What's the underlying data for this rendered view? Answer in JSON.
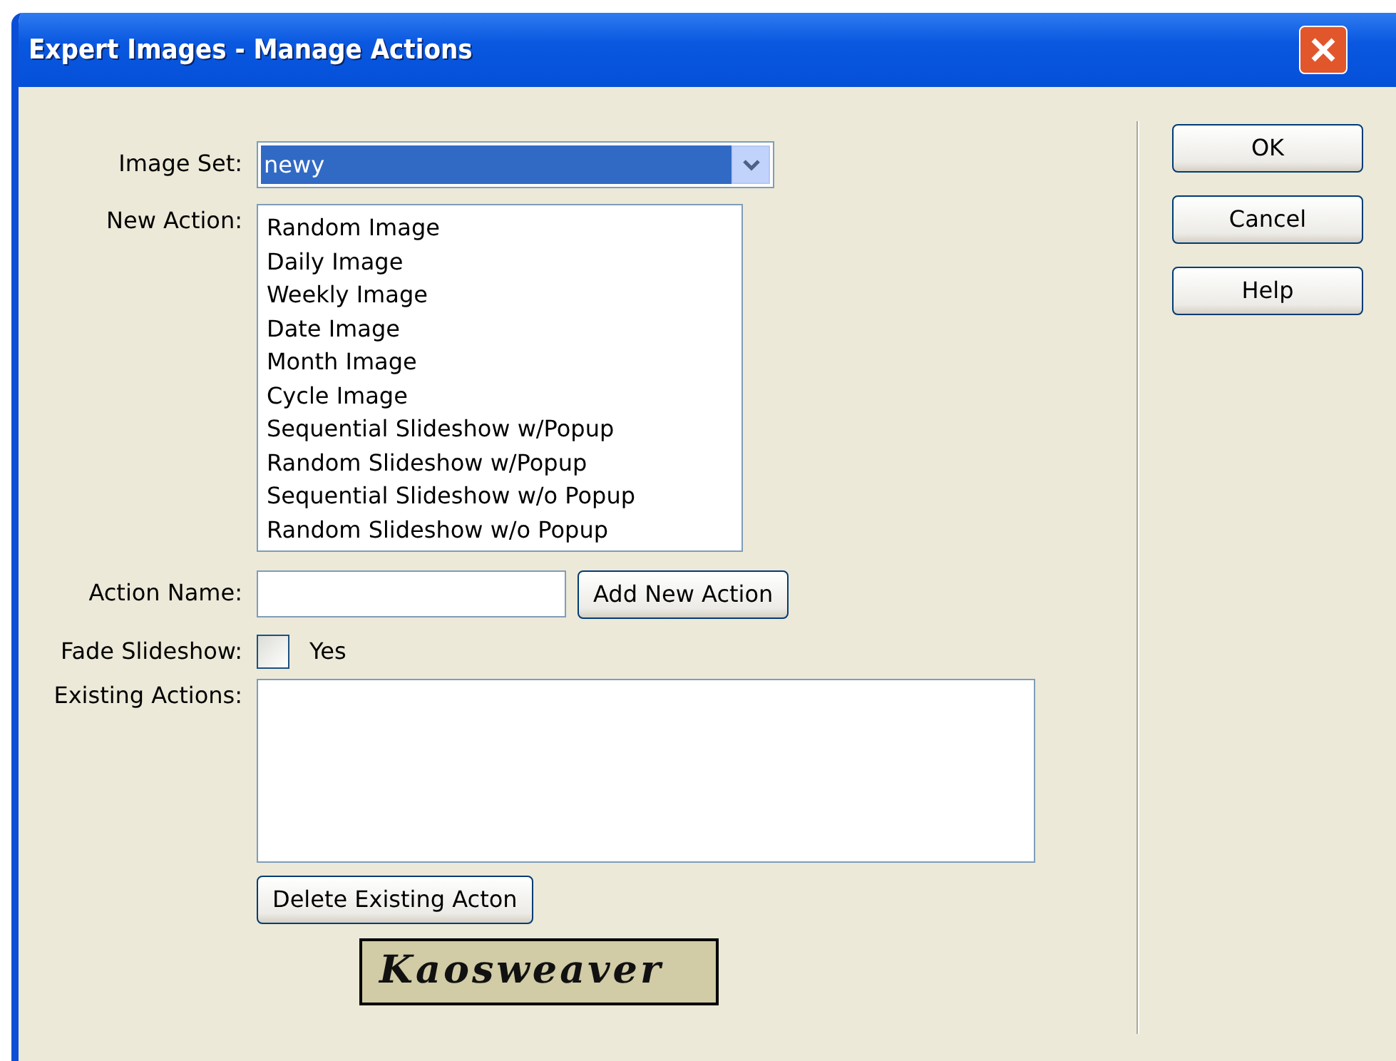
{
  "window": {
    "title": "Expert Images - Manage Actions"
  },
  "image_set": {
    "label": "Image Set:",
    "value": "newy",
    "highlighted": true
  },
  "new_action": {
    "label": "New Action:",
    "items": [
      {
        "label": "Random Image"
      },
      {
        "label": "Daily Image"
      },
      {
        "label": "Weekly Image"
      },
      {
        "label": "Date Image"
      },
      {
        "label": "Month Image"
      },
      {
        "label": "Cycle Image"
      },
      {
        "label": "Sequential Slideshow w/Popup"
      },
      {
        "label": "Random Slideshow w/Popup"
      },
      {
        "label": "Sequential Slideshow w/o Popup"
      },
      {
        "label": "Random Slideshow w/o Popup"
      }
    ]
  },
  "action_name": {
    "label": "Action Name:",
    "button": "Add New Action"
  },
  "fade_slideshow": {
    "label": "Fade Slideshow:",
    "option": "Yes",
    "checked": false
  },
  "existing_actions": {
    "label": "Existing Actions:",
    "button": "Delete Existing Acton"
  },
  "logo": {
    "text": "Kaosweaver"
  },
  "buttons": [
    "OK",
    "Cancel",
    "Help"
  ]
}
